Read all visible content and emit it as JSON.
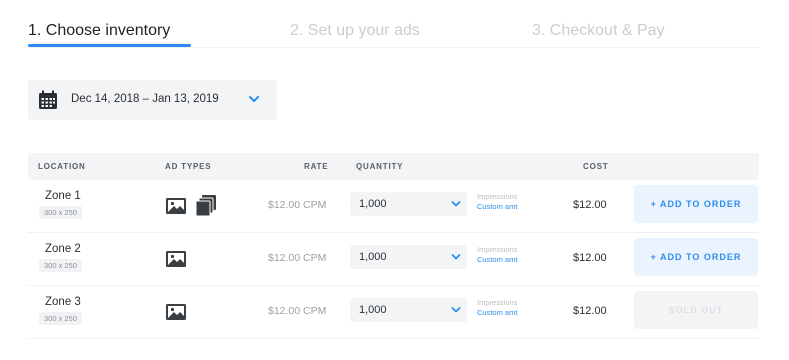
{
  "steps": [
    {
      "label": "1. Choose inventory"
    },
    {
      "label": "2. Set up your ads"
    },
    {
      "label": "3. Checkout & Pay"
    }
  ],
  "date_range": {
    "value": "Dec 14, 2018 – Jan 13, 2019",
    "icon": "calendar-icon"
  },
  "table": {
    "headers": {
      "location": "LOCATION",
      "ad_types": "AD TYPES",
      "rate": "RATE",
      "quantity": "QUANTITY",
      "cost": "COST"
    },
    "rows": [
      {
        "zone": "Zone 1",
        "size": "300 x 250",
        "ad_types": [
          "image-ad-icon",
          "multi-image-ad-icon"
        ],
        "rate": "$12.00 CPM",
        "quantity": "1,000",
        "unit": "Impressions",
        "custom": "Custom amt",
        "cost": "$12.00",
        "action": "+ ADD TO ORDER",
        "sold_out": false
      },
      {
        "zone": "Zone 2",
        "size": "300 x 250",
        "ad_types": [
          "image-ad-icon"
        ],
        "rate": "$12.00 CPM",
        "quantity": "1,000",
        "unit": "Impressions",
        "custom": "Custom amt",
        "cost": "$12.00",
        "action": "+ ADD TO ORDER",
        "sold_out": false
      },
      {
        "zone": "Zone 3",
        "size": "300 x 250",
        "ad_types": [
          "image-ad-icon"
        ],
        "rate": "$12.00 CPM",
        "quantity": "1,000",
        "unit": "Impressions",
        "custom": "Custom amt",
        "cost": "$12.00",
        "action": "SOLD OUT",
        "sold_out": true
      }
    ]
  },
  "colors": {
    "accent": "#2e8cf0",
    "accent_bg": "#ebf4fe",
    "muted_bg": "#f3f4f6"
  }
}
